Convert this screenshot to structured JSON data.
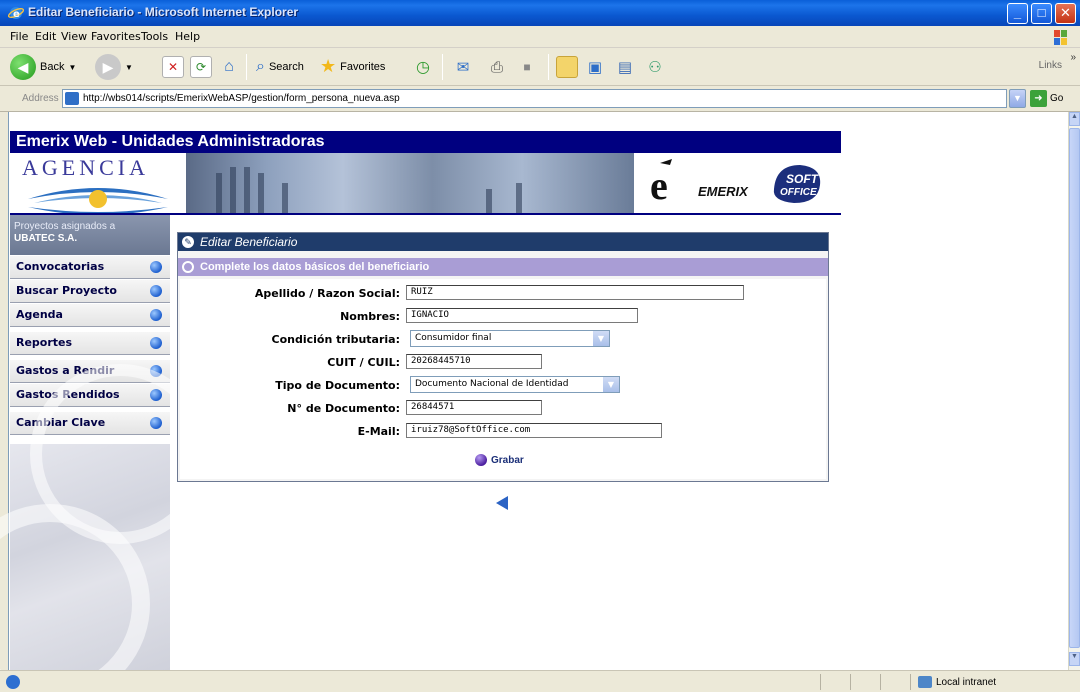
{
  "window": {
    "title": "Editar Beneficiario - Microsoft Internet Explorer"
  },
  "menu": [
    "File",
    "Edit",
    "View",
    "Favorites",
    "Tools",
    "Help"
  ],
  "toolbar": {
    "back_label": "Back",
    "search_label": "Search",
    "favorites_label": "Favorites",
    "links_label": "Links"
  },
  "address": {
    "label": "Address",
    "url": "http://wbs014/scripts/EmerixWebASP/gestion/form_persona_nueva.asp",
    "go_label": "Go"
  },
  "page": {
    "header_title": "Emerix Web - Unidades Administradoras",
    "agencia_text": "AGENCIA",
    "emerix_text": "EMERIX",
    "soft_office_text": "SOFT OFFICE"
  },
  "sidebar": {
    "project_line1": "Proyectos asignados a",
    "project_line2": "UBATEC S.A.",
    "items": [
      {
        "label": "Convocatorias"
      },
      {
        "label": "Buscar Proyecto"
      },
      {
        "label": "Agenda"
      },
      {
        "label": "Reportes"
      },
      {
        "label": "Gastos a Rendir"
      },
      {
        "label": "Gastos Rendidos"
      },
      {
        "label": "Cambiar Clave"
      }
    ]
  },
  "form": {
    "panel_title": "Editar Beneficiario",
    "subtitle": "Complete los datos básicos del beneficiario",
    "fields": {
      "apellido": {
        "label": "Apellido / Razon Social:",
        "value": "RUIZ"
      },
      "nombres": {
        "label": "Nombres:",
        "value": "IGNACIO"
      },
      "condicion": {
        "label": "Condición tributaria:",
        "value": "Consumidor final"
      },
      "cuit": {
        "label": "CUIT / CUIL:",
        "value": "20268445710"
      },
      "tipo_doc": {
        "label": "Tipo de Documento:",
        "value": "Documento Nacional de Identidad"
      },
      "nro_doc": {
        "label": "N° de Documento:",
        "value": "26844571"
      },
      "email": {
        "label": "E-Mail:",
        "value": "iruiz78@SoftOffice.com"
      }
    },
    "save_label": "Grabar"
  },
  "status": {
    "zone_label": "Local intranet"
  },
  "colors": {
    "header_bar": "#000080",
    "panel_head": "#1f3c6b",
    "panel_sub": "#a99dd5"
  }
}
